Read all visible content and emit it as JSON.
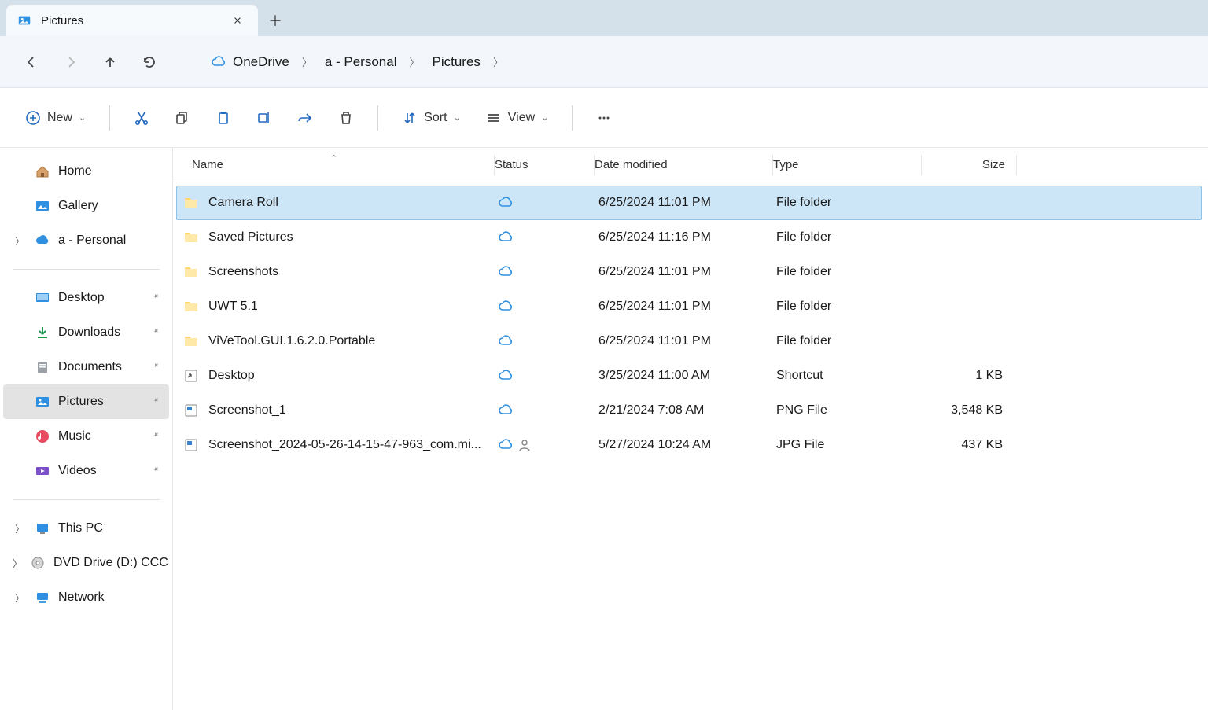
{
  "tab": {
    "title": "Pictures"
  },
  "breadcrumb": [
    {
      "label": "OneDrive",
      "icon": "cloud"
    },
    {
      "label": "a - Personal"
    },
    {
      "label": "Pictures"
    }
  ],
  "toolbar": {
    "new_label": "New",
    "sort_label": "Sort",
    "view_label": "View"
  },
  "sidebar": {
    "top": [
      {
        "label": "Home",
        "icon": "home"
      },
      {
        "label": "Gallery",
        "icon": "gallery"
      },
      {
        "label": "a - Personal",
        "icon": "onedrive",
        "chevron": true
      }
    ],
    "quick": [
      {
        "label": "Desktop",
        "icon": "desktop",
        "pinned": true
      },
      {
        "label": "Downloads",
        "icon": "downloads",
        "pinned": true
      },
      {
        "label": "Documents",
        "icon": "documents",
        "pinned": true
      },
      {
        "label": "Pictures",
        "icon": "pictures",
        "pinned": true,
        "selected": true
      },
      {
        "label": "Music",
        "icon": "music",
        "pinned": true
      },
      {
        "label": "Videos",
        "icon": "videos",
        "pinned": true
      }
    ],
    "bottom": [
      {
        "label": "This PC",
        "icon": "pc",
        "chevron": true
      },
      {
        "label": "DVD Drive (D:) CCC",
        "icon": "dvd",
        "chevron": true
      },
      {
        "label": "Network",
        "icon": "network",
        "chevron": true
      }
    ]
  },
  "columns": {
    "name": "Name",
    "status": "Status",
    "date": "Date modified",
    "type": "Type",
    "size": "Size"
  },
  "files": [
    {
      "name": "Camera Roll",
      "icon": "folder",
      "status": [
        "cloud"
      ],
      "date": "6/25/2024 11:01 PM",
      "type": "File folder",
      "size": "",
      "selected": true
    },
    {
      "name": "Saved Pictures",
      "icon": "folder",
      "status": [
        "cloud"
      ],
      "date": "6/25/2024 11:16 PM",
      "type": "File folder",
      "size": ""
    },
    {
      "name": "Screenshots",
      "icon": "folder",
      "status": [
        "cloud"
      ],
      "date": "6/25/2024 11:01 PM",
      "type": "File folder",
      "size": ""
    },
    {
      "name": "UWT 5.1",
      "icon": "folder",
      "status": [
        "cloud"
      ],
      "date": "6/25/2024 11:01 PM",
      "type": "File folder",
      "size": ""
    },
    {
      "name": "ViVeTool.GUI.1.6.2.0.Portable",
      "icon": "folder",
      "status": [
        "cloud"
      ],
      "date": "6/25/2024 11:01 PM",
      "type": "File folder",
      "size": ""
    },
    {
      "name": "Desktop",
      "icon": "shortcut",
      "status": [
        "cloud"
      ],
      "date": "3/25/2024 11:00 AM",
      "type": "Shortcut",
      "size": "1 KB"
    },
    {
      "name": "Screenshot_1",
      "icon": "image",
      "status": [
        "cloud"
      ],
      "date": "2/21/2024 7:08 AM",
      "type": "PNG File",
      "size": "3,548 KB"
    },
    {
      "name": "Screenshot_2024-05-26-14-15-47-963_com.mi...",
      "icon": "image",
      "status": [
        "cloud",
        "person"
      ],
      "date": "5/27/2024 10:24 AM",
      "type": "JPG File",
      "size": "437 KB"
    }
  ]
}
